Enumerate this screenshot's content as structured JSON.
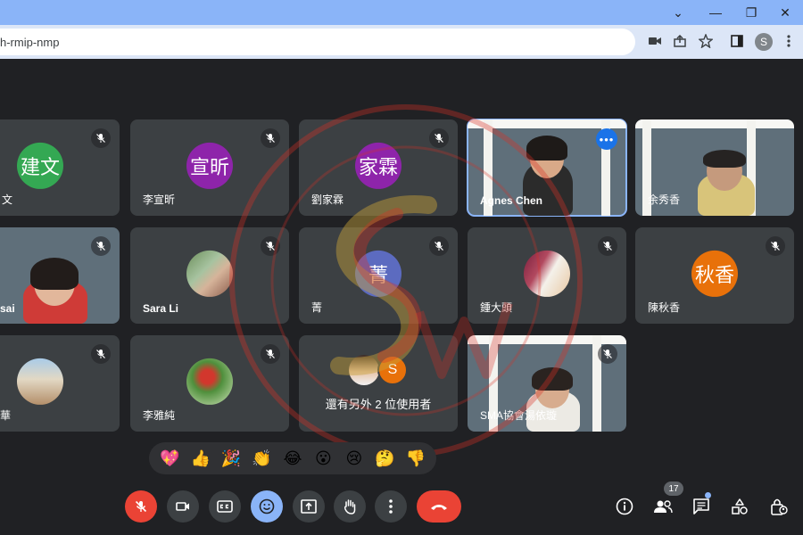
{
  "browser": {
    "url": "h-rmip-nmp",
    "profile_initial": "S",
    "window_controls": {
      "minimize": "⌄",
      "maximize": "—",
      "restore": "❐",
      "close": "✕"
    }
  },
  "tiles": [
    {
      "name": "文",
      "avatar": "建文",
      "avatar_color": "#34a853",
      "muted": true
    },
    {
      "name": "李宣昕",
      "avatar": "宣昕",
      "avatar_color": "#8e24aa",
      "muted": true
    },
    {
      "name": "劉家霖",
      "avatar": "家霖",
      "avatar_color": "#8e24aa",
      "muted": true
    },
    {
      "name": "Agnes Chen",
      "video": true,
      "active": true
    },
    {
      "name": "余秀香",
      "video": true
    },
    {
      "name": "sai",
      "video": true,
      "muted": true
    },
    {
      "name": "Sara Li",
      "muted": true
    },
    {
      "name": "菁",
      "avatar": "菁",
      "avatar_color": "#5c6bc0",
      "muted": true
    },
    {
      "name": "鍾大頭",
      "muted": true
    },
    {
      "name": "陳秋香",
      "avatar": "秋香",
      "avatar_color": "#e8710a",
      "muted": true
    },
    {
      "name": "華",
      "muted": true
    },
    {
      "name": "李雅純",
      "muted": true
    },
    {
      "name": "還有另外 2 位使用者",
      "overflow_initial": "S",
      "overflow_color": "#e8710a"
    },
    {
      "name": "SMA協會湯依璇",
      "video": true,
      "muted": true
    }
  ],
  "reactions": [
    "💖",
    "👍",
    "🎉",
    "👏",
    "😂",
    "😮",
    "😢",
    "🤔",
    "👎"
  ],
  "controls": {
    "participant_count": "17"
  },
  "colors": {
    "background": "#202124",
    "tile": "#3c4043",
    "accent": "#8ab4f8",
    "danger": "#ea4335"
  }
}
